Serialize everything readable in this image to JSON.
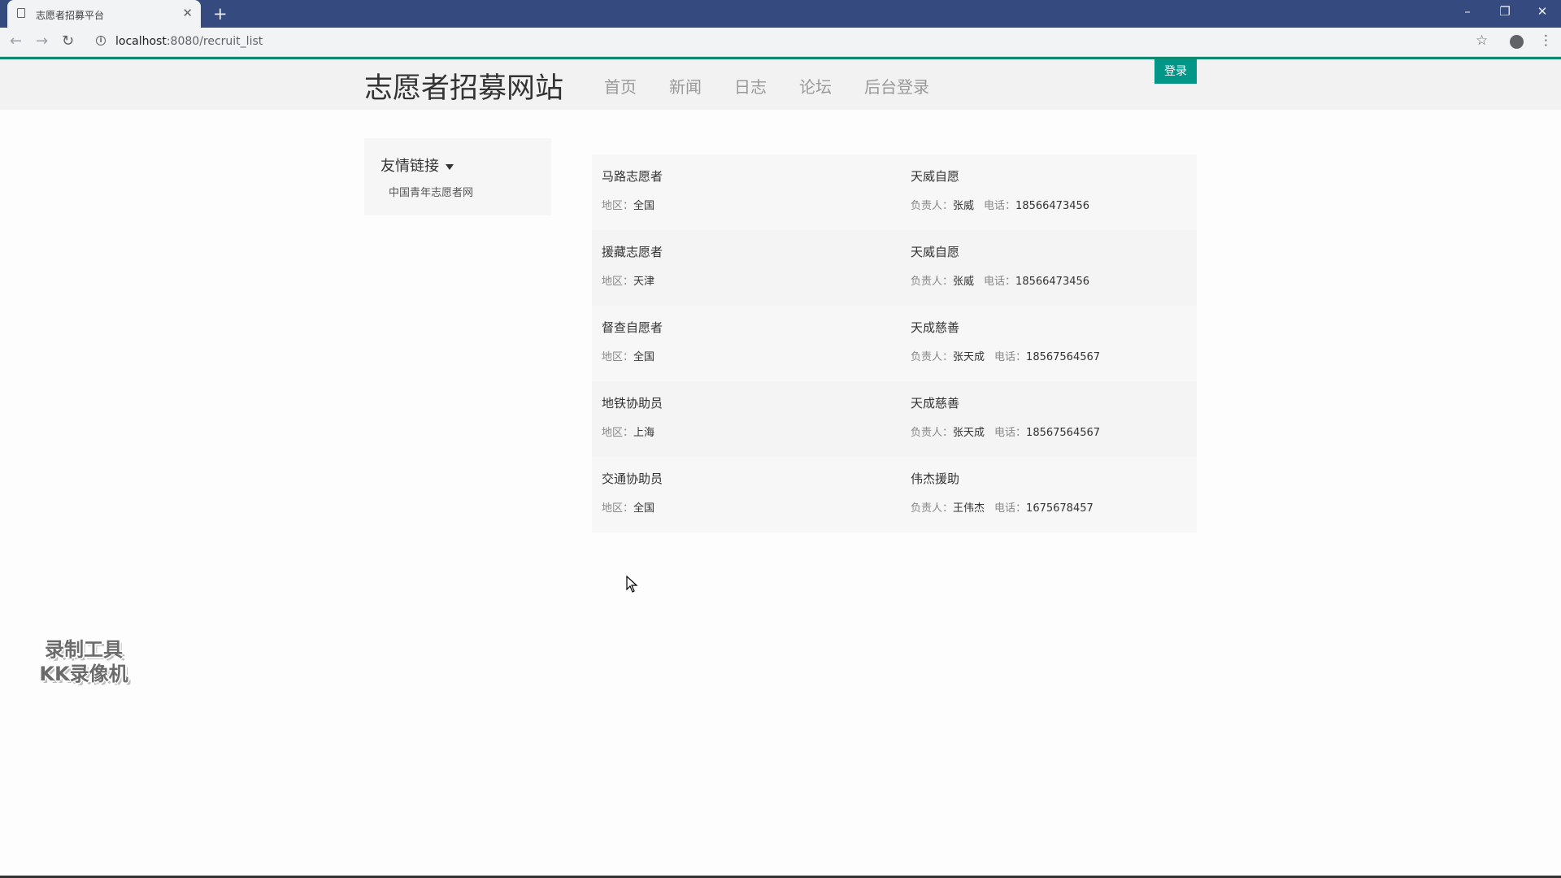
{
  "browser": {
    "tab_title": "志愿者招募平台",
    "tab_close": "✕",
    "new_tab": "+",
    "url_host": "localhost",
    "url_rest": ":8080/recruit_list",
    "back": "←",
    "forward": "→",
    "reload": "↻",
    "star": "☆",
    "menu": "⋮",
    "minimize": "–",
    "restore": "❐",
    "close": "✕"
  },
  "header": {
    "site_title": "志愿者招募网站",
    "nav": [
      "首页",
      "新闻",
      "日志",
      "论坛",
      "后台登录"
    ],
    "login_label": "登录"
  },
  "sidebar": {
    "heading": "友情链接",
    "links": [
      "中国青年志愿者网"
    ]
  },
  "labels": {
    "region": "地区：",
    "manager": "负责人：",
    "phone": "电话："
  },
  "recruits": [
    {
      "name": "马路志愿者",
      "region": "全国",
      "org": "天威自愿",
      "manager": "张威",
      "phone": "18566473456"
    },
    {
      "name": "援藏志愿者",
      "region": "天津",
      "org": "天威自愿",
      "manager": "张威",
      "phone": "18566473456"
    },
    {
      "name": "督查自愿者",
      "region": "全国",
      "org": "天成慈善",
      "manager": "张天成",
      "phone": "18567564567"
    },
    {
      "name": "地铁协助员",
      "region": "上海",
      "org": "天成慈善",
      "manager": "张天成",
      "phone": "18567564567"
    },
    {
      "name": "交通协助员",
      "region": "全国",
      "org": "伟杰援助",
      "manager": "王伟杰",
      "phone": "1675678457"
    }
  ],
  "watermark": {
    "line1": "录制工具",
    "line2": "KK录像机"
  },
  "colors": {
    "tabstrip": "#354a7e",
    "accent": "#009688"
  },
  "icons": {
    "page": "document-icon",
    "info": "info-icon",
    "profile": "profile-icon",
    "caret": "caret-down-icon",
    "cursor": "mouse-cursor-icon"
  }
}
